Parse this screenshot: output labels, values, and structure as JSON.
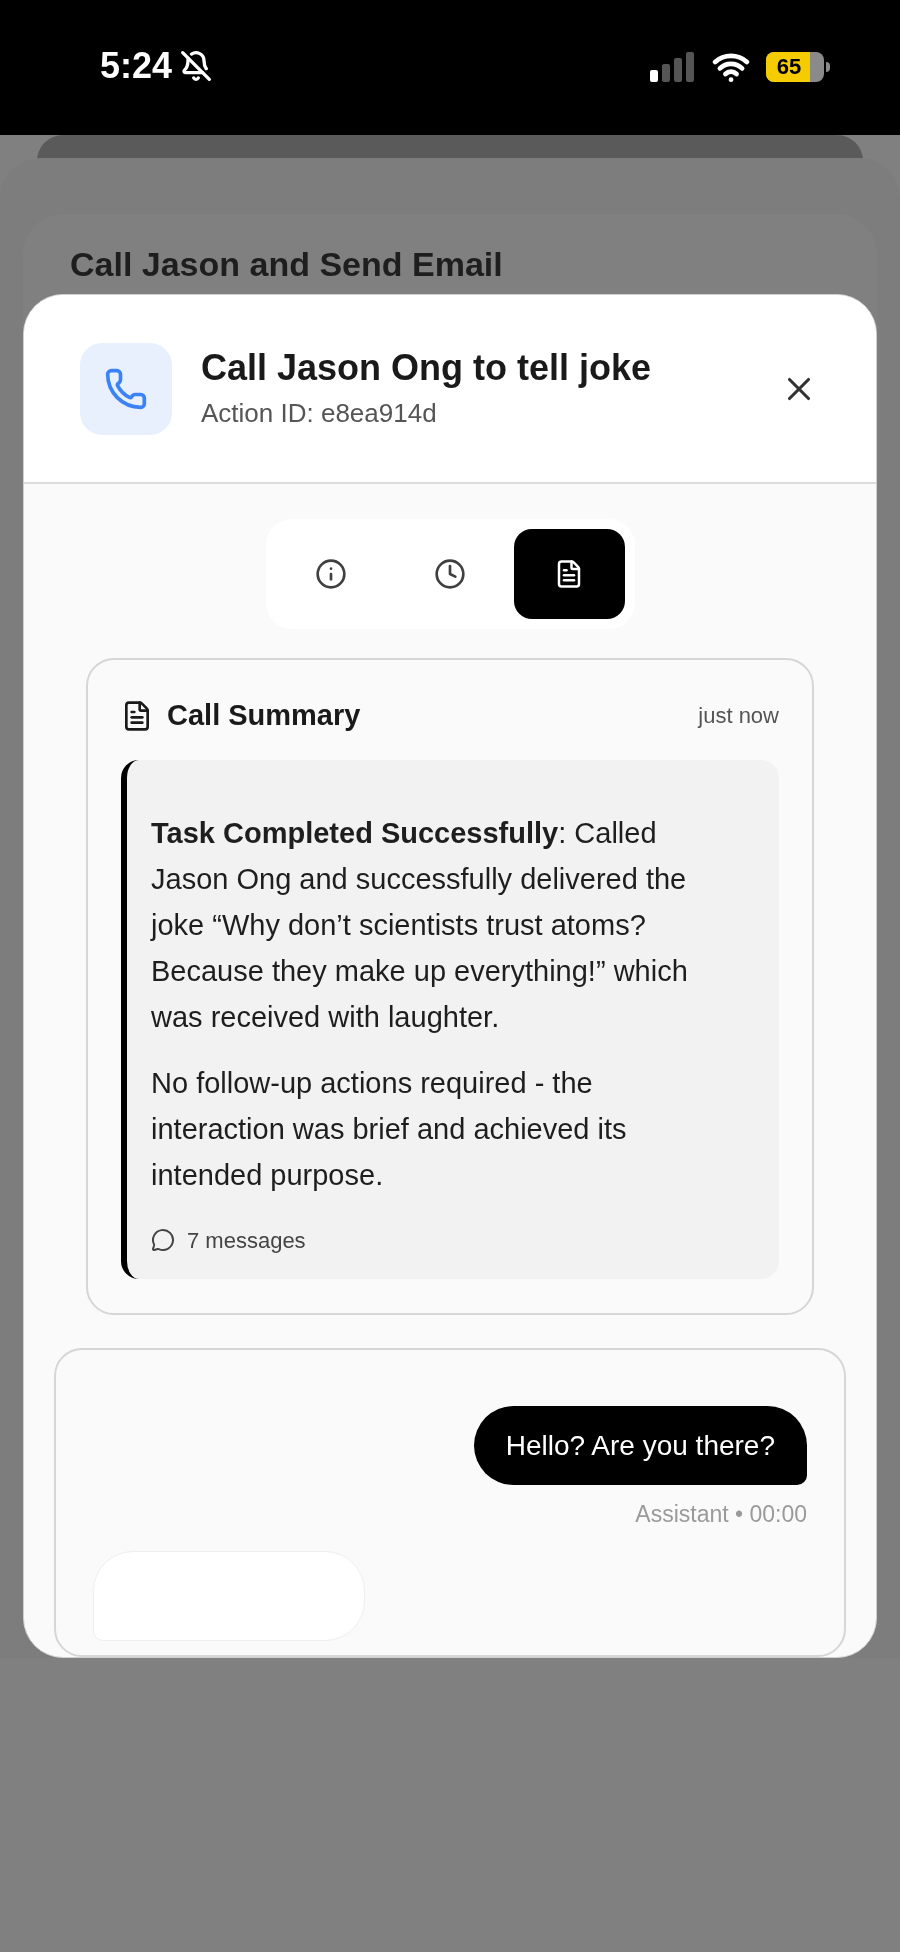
{
  "status_bar": {
    "time": "5:24",
    "battery": "65"
  },
  "background_card": {
    "title": "Call Jason and Send Email"
  },
  "modal": {
    "title": "Call Jason Ong to tell joke",
    "subtitle": "Action ID: e8ea914d"
  },
  "tabs": [
    {
      "kind": "info",
      "selected": false
    },
    {
      "kind": "history",
      "selected": false
    },
    {
      "kind": "summary",
      "selected": true
    }
  ],
  "summary": {
    "title": "Call Summary",
    "time": "just now",
    "paragraphs": [
      "**Task Completed Successfully**: Called Jason Ong and successfully delivered the joke “Why don’t scientists trust atoms? Because they make up everything!” which was received with laughter.",
      "No follow-up actions required - the interaction was brief and achieved its intended purpose."
    ],
    "message_count": "7 messages"
  },
  "messages": [
    {
      "kind": "outgoing",
      "text": "Hello? Are you there?",
      "meta": "Assistant • 00:00"
    },
    {
      "kind": "incoming"
    }
  ]
}
